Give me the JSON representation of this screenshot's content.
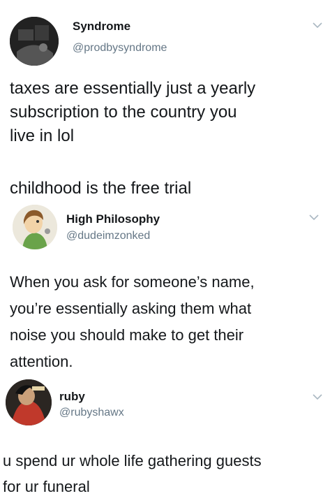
{
  "tweets": [
    {
      "name": "Syndrome",
      "handle": "@prodbysyndrome",
      "body_lines": [
        "taxes are essentially just a yearly",
        "subscription to the country you",
        "live in lol"
      ],
      "reply_lines": [
        "childhood is the free trial"
      ]
    },
    {
      "name": "High Philosophy",
      "handle": "@dudeimzonked",
      "body_lines": [
        "When you ask for someone’s name,",
        "you’re essentially asking them what",
        "noise you should make to get their",
        "attention."
      ]
    },
    {
      "name": "ruby",
      "handle": "@rubyshawx",
      "body_lines": [
        "u spend ur whole life gathering guests",
        "for ur funeral"
      ]
    }
  ],
  "colors": {
    "text": "#14171a",
    "handle": "#657786",
    "chevron": "#aab8c2"
  },
  "icons": [
    "chevron-down-icon"
  ]
}
